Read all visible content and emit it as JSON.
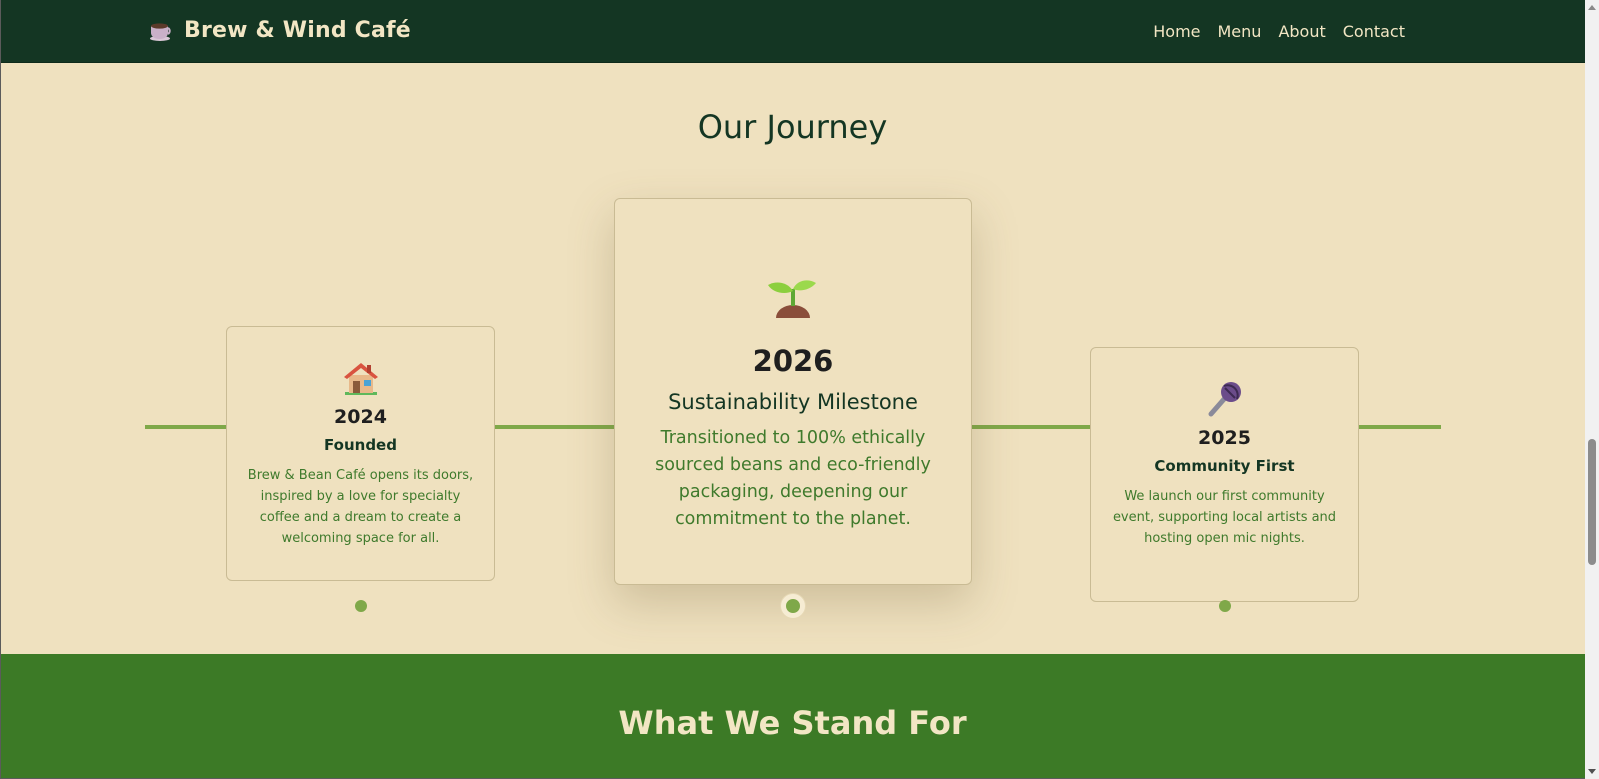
{
  "navbar": {
    "brand_icon": "coffee-cup-icon",
    "brand_name": "Brew & Wind Café",
    "links": [
      "Home",
      "Menu",
      "About",
      "Contact"
    ]
  },
  "journey": {
    "title": "Our Journey",
    "cards": [
      {
        "icon": "house-icon",
        "year": "2024",
        "heading": "Founded",
        "description": "Brew & Bean Café opens its doors, inspired by a love for specialty coffee and a dream to create a welcoming space for all."
      },
      {
        "icon": "seedling-icon",
        "year": "2026",
        "heading": "Sustainability Milestone",
        "description": "Transitioned to 100% ethically sourced beans and eco-friendly packaging, deepening our commitment to the planet."
      },
      {
        "icon": "microphone-icon",
        "year": "2025",
        "heading": "Community First",
        "description": "We launch our first community event, supporting local artists and hosting open mic nights."
      }
    ],
    "active_card_index": 1
  },
  "values": {
    "title": "What We Stand For"
  },
  "colors": {
    "nav_bg": "#143623",
    "page_bg": "#efe1bf",
    "accent_green": "#7fa849",
    "values_bg": "#3c7a26",
    "cream_text": "#f2e6c4"
  }
}
